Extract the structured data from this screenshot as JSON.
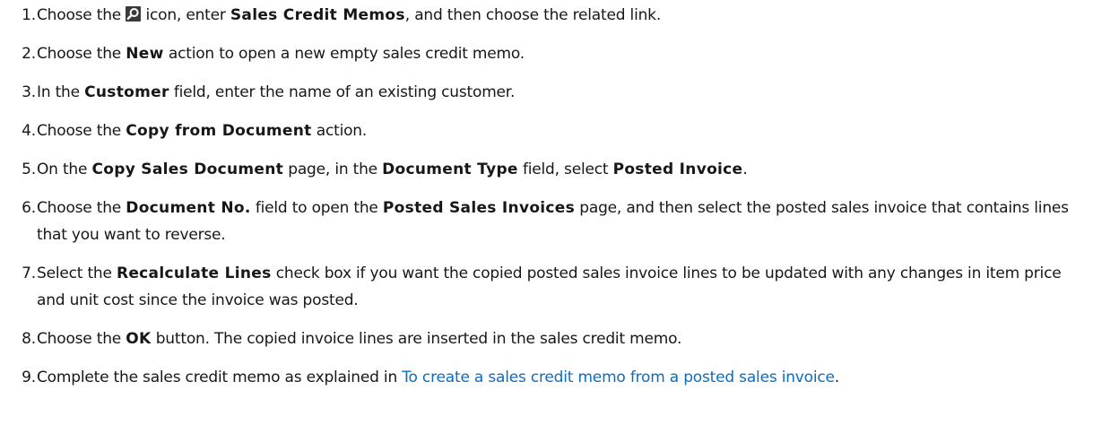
{
  "steps": [
    {
      "number": "1.",
      "parts": [
        {
          "type": "text",
          "text": "Choose the "
        },
        {
          "type": "icon",
          "name": "search-icon"
        },
        {
          "type": "text",
          "text": " icon, enter "
        },
        {
          "type": "bold",
          "text": "Sales Credit Memos"
        },
        {
          "type": "text",
          "text": ", and then choose the related link."
        }
      ]
    },
    {
      "number": "2.",
      "parts": [
        {
          "type": "text",
          "text": "Choose the "
        },
        {
          "type": "bold",
          "text": "New"
        },
        {
          "type": "text",
          "text": " action to open a new empty sales credit memo."
        }
      ]
    },
    {
      "number": "3.",
      "parts": [
        {
          "type": "text",
          "text": "In the "
        },
        {
          "type": "bold",
          "text": "Customer"
        },
        {
          "type": "text",
          "text": " field, enter the name of an existing customer."
        }
      ]
    },
    {
      "number": "4.",
      "parts": [
        {
          "type": "text",
          "text": "Choose the "
        },
        {
          "type": "bold",
          "text": "Copy from Document"
        },
        {
          "type": "text",
          "text": " action."
        }
      ]
    },
    {
      "number": "5.",
      "parts": [
        {
          "type": "text",
          "text": "On the "
        },
        {
          "type": "bold",
          "text": "Copy Sales Document"
        },
        {
          "type": "text",
          "text": " page, in the "
        },
        {
          "type": "bold",
          "text": "Document Type"
        },
        {
          "type": "text",
          "text": " field, select "
        },
        {
          "type": "bold",
          "text": "Posted Invoice"
        },
        {
          "type": "text",
          "text": "."
        }
      ]
    },
    {
      "number": "6.",
      "parts": [
        {
          "type": "text",
          "text": "Choose the "
        },
        {
          "type": "bold",
          "text": "Document No."
        },
        {
          "type": "text",
          "text": " field to open the "
        },
        {
          "type": "bold",
          "text": "Posted Sales Invoices"
        },
        {
          "type": "text",
          "text": " page, and then select the posted sales invoice that contains lines that you want to reverse."
        }
      ]
    },
    {
      "number": "7.",
      "parts": [
        {
          "type": "text",
          "text": "Select the "
        },
        {
          "type": "bold",
          "text": "Recalculate Lines"
        },
        {
          "type": "text",
          "text": " check box if you want the copied posted sales invoice lines to be updated with any changes in item price and unit cost since the invoice was posted."
        }
      ]
    },
    {
      "number": "8.",
      "parts": [
        {
          "type": "text",
          "text": "Choose the "
        },
        {
          "type": "bold",
          "text": "OK"
        },
        {
          "type": "text",
          "text": " button. The copied invoice lines are inserted in the sales credit memo."
        }
      ]
    },
    {
      "number": "9.",
      "parts": [
        {
          "type": "text",
          "text": "Complete the sales credit memo as explained in "
        },
        {
          "type": "link",
          "text": "To create a sales credit memo from a posted sales invoice"
        },
        {
          "type": "text",
          "text": "."
        }
      ]
    }
  ],
  "colors": {
    "text": "#171717",
    "link": "#0f6cbd"
  }
}
